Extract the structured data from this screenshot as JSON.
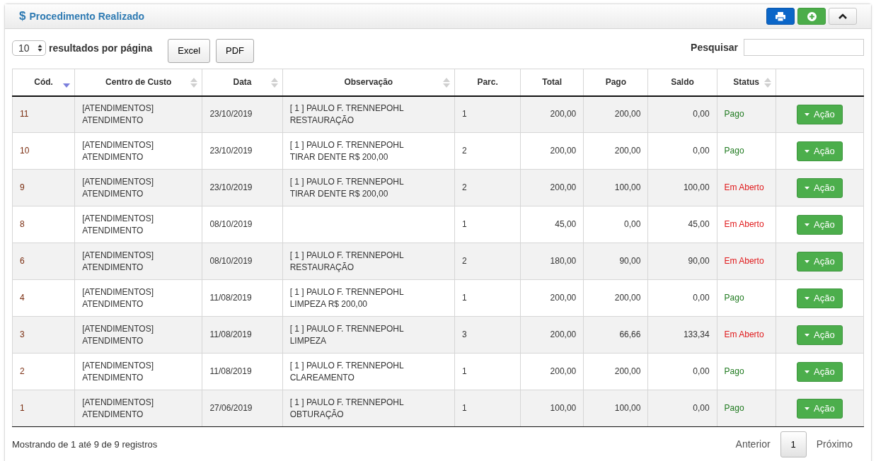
{
  "panel": {
    "title_icon": "$",
    "title": "Procedimento Realizado"
  },
  "controls": {
    "page_size": "10",
    "page_size_label": "resultados por página",
    "export_buttons": [
      "Excel",
      "PDF"
    ],
    "search_label": "Pesquisar"
  },
  "table": {
    "columns": [
      {
        "label": "Cód.",
        "sortable": true,
        "sorted": true
      },
      {
        "label": "Centro de Custo",
        "sortable": true,
        "sorted": false
      },
      {
        "label": "Data",
        "sortable": true,
        "sorted": false
      },
      {
        "label": "Observação",
        "sortable": true,
        "sorted": false
      },
      {
        "label": "Parc.",
        "sortable": false
      },
      {
        "label": "Total",
        "sortable": false
      },
      {
        "label": "Pago",
        "sortable": false
      },
      {
        "label": "Saldo",
        "sortable": false
      },
      {
        "label": "Status",
        "sortable": true,
        "sorted": false
      }
    ],
    "rows": [
      {
        "cod": "11",
        "centro": [
          "[ATENDIMENTOS]",
          "ATENDIMENTO"
        ],
        "data": "23/10/2019",
        "obs": [
          "[ 1 ] PAULO F. TRENNEPOHL",
          "RESTAURAÇÃO"
        ],
        "parc": "1",
        "total": "200,00",
        "pago": "200,00",
        "saldo": "0,00",
        "status": "Pago",
        "kind": "paid",
        "action": "Ação"
      },
      {
        "cod": "10",
        "centro": [
          "[ATENDIMENTOS]",
          "ATENDIMENTO"
        ],
        "data": "23/10/2019",
        "obs": [
          "[ 1 ] PAULO F. TRENNEPOHL",
          "TIRAR DENTE R$ 200,00"
        ],
        "parc": "2",
        "total": "200,00",
        "pago": "200,00",
        "saldo": "0,00",
        "status": "Pago",
        "kind": "paid",
        "action": "Ação"
      },
      {
        "cod": "9",
        "centro": [
          "[ATENDIMENTOS]",
          "ATENDIMENTO"
        ],
        "data": "23/10/2019",
        "obs": [
          "[ 1 ] PAULO F. TRENNEPOHL",
          "TIRAR DENTE R$ 200,00"
        ],
        "parc": "2",
        "total": "200,00",
        "pago": "100,00",
        "saldo": "100,00",
        "status": "Em Aberto",
        "kind": "open",
        "action": "Ação"
      },
      {
        "cod": "8",
        "centro": [
          "[ATENDIMENTOS]",
          "ATENDIMENTO"
        ],
        "data": "08/10/2019",
        "obs": [],
        "parc": "1",
        "total": "45,00",
        "pago": "0,00",
        "saldo": "45,00",
        "status": "Em Aberto",
        "kind": "open",
        "action": "Ação"
      },
      {
        "cod": "6",
        "centro": [
          "[ATENDIMENTOS]",
          "ATENDIMENTO"
        ],
        "data": "08/10/2019",
        "obs": [
          "[ 1 ] PAULO F. TRENNEPOHL",
          "RESTAURAÇÃO"
        ],
        "parc": "2",
        "total": "180,00",
        "pago": "90,00",
        "saldo": "90,00",
        "status": "Em Aberto",
        "kind": "open",
        "action": "Ação"
      },
      {
        "cod": "4",
        "centro": [
          "[ATENDIMENTOS]",
          "ATENDIMENTO"
        ],
        "data": "11/08/2019",
        "obs": [
          "[ 1 ] PAULO F. TRENNEPOHL",
          "LIMPEZA R$ 200,00"
        ],
        "parc": "1",
        "total": "200,00",
        "pago": "200,00",
        "saldo": "0,00",
        "status": "Pago",
        "kind": "paid",
        "action": "Ação"
      },
      {
        "cod": "3",
        "centro": [
          "[ATENDIMENTOS]",
          "ATENDIMENTO"
        ],
        "data": "11/08/2019",
        "obs": [
          "[ 1 ] PAULO F. TRENNEPOHL",
          "LIMPEZA"
        ],
        "parc": "3",
        "total": "200,00",
        "pago": "66,66",
        "saldo": "133,34",
        "status": "Em Aberto",
        "kind": "open",
        "action": "Ação"
      },
      {
        "cod": "2",
        "centro": [
          "[ATENDIMENTOS]",
          "ATENDIMENTO"
        ],
        "data": "11/08/2019",
        "obs": [
          "[ 1 ] PAULO F. TRENNEPOHL",
          "CLAREAMENTO"
        ],
        "parc": "1",
        "total": "200,00",
        "pago": "200,00",
        "saldo": "0,00",
        "status": "Pago",
        "kind": "paid",
        "action": "Ação"
      },
      {
        "cod": "1",
        "centro": [
          "[ATENDIMENTOS]",
          "ATENDIMENTO"
        ],
        "data": "27/06/2019",
        "obs": [
          "[ 1 ] PAULO F. TRENNEPOHL",
          "OBTURAÇÃO"
        ],
        "parc": "1",
        "total": "100,00",
        "pago": "100,00",
        "saldo": "0,00",
        "status": "Pago",
        "kind": "paid",
        "action": "Ação"
      }
    ]
  },
  "footer": {
    "info": "Mostrando de 1 até 9 de 9 registros",
    "previous": "Anterior",
    "pages": [
      {
        "label": "1",
        "selected": true
      }
    ],
    "next": "Próximo"
  }
}
